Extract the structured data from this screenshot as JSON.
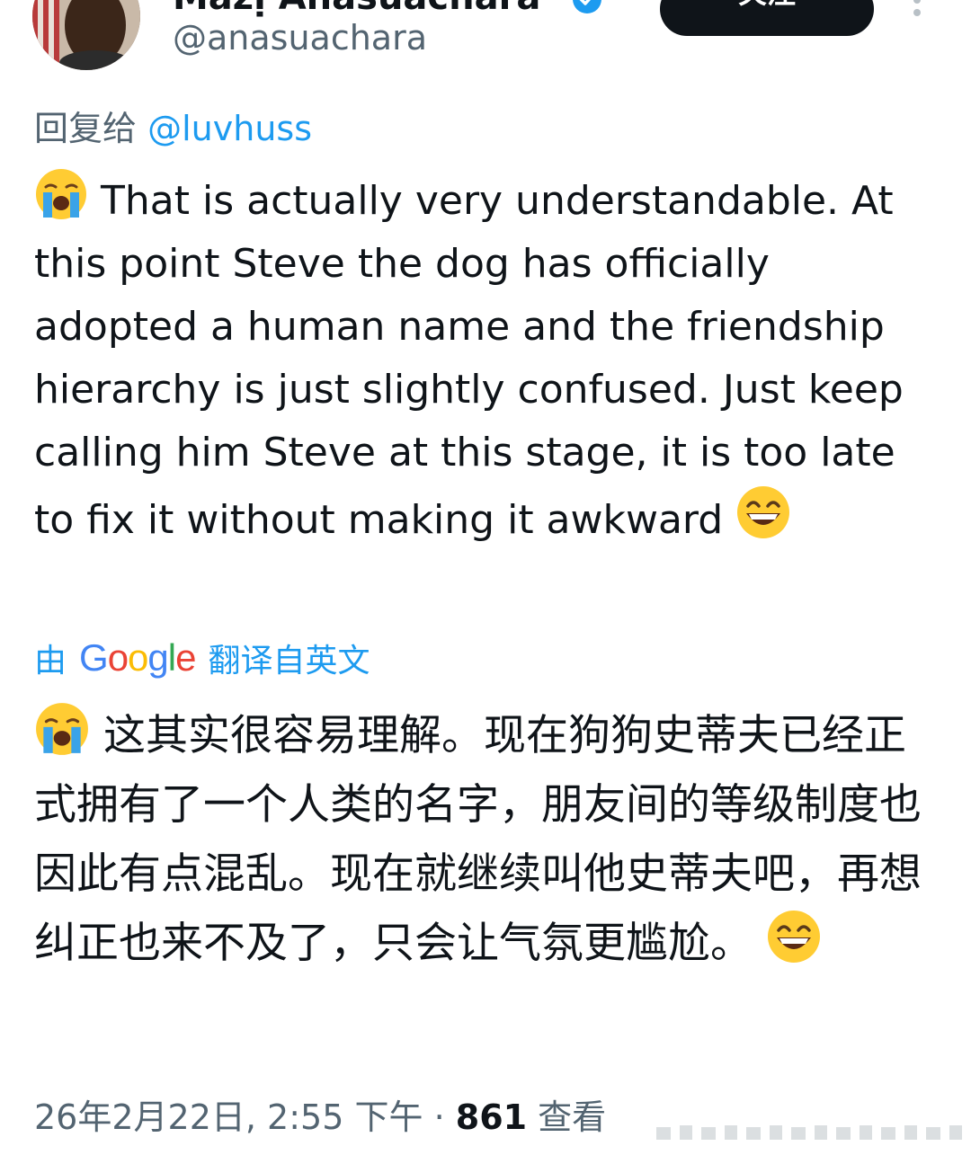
{
  "author": {
    "display_name": "Mazị Anasuachara",
    "handle": "@anasuachara",
    "verified": true
  },
  "follow_button_label": "关注",
  "reply_to": {
    "prefix": "回复给",
    "handle": "@luvhuss"
  },
  "tweet": {
    "leading_emoji": "loudly-crying-face",
    "text": "That is actually very understandable. At this point Steve the dog has officially adopted a human name and the friendship hierarchy is just slightly confused. Just keep calling him Steve at this stage, it is too late to fix it without making it awkward",
    "trailing_emoji": "grinning-face-with-smiling-eyes"
  },
  "translation": {
    "prefix": "由",
    "provider": "Google",
    "suffix": "翻译自英文",
    "text": "这其实很容易理解。现在狗狗史蒂夫已经正式拥有了一个人类的名字，朋友间的等级制度也因此有点混乱。现在就继续叫他史蒂夫吧，再想纠正也来不及了，只会让气氛更尴尬。"
  },
  "meta": {
    "datetime": "26年2月22日, 2:55 下午",
    "separator": "·",
    "views_count": "861",
    "views_label": "查看"
  },
  "colors": {
    "accent": "#1d9bf0",
    "secondary_text": "#536471",
    "primary_text": "#0f1419",
    "follow_button_bg": "#0f1419"
  }
}
